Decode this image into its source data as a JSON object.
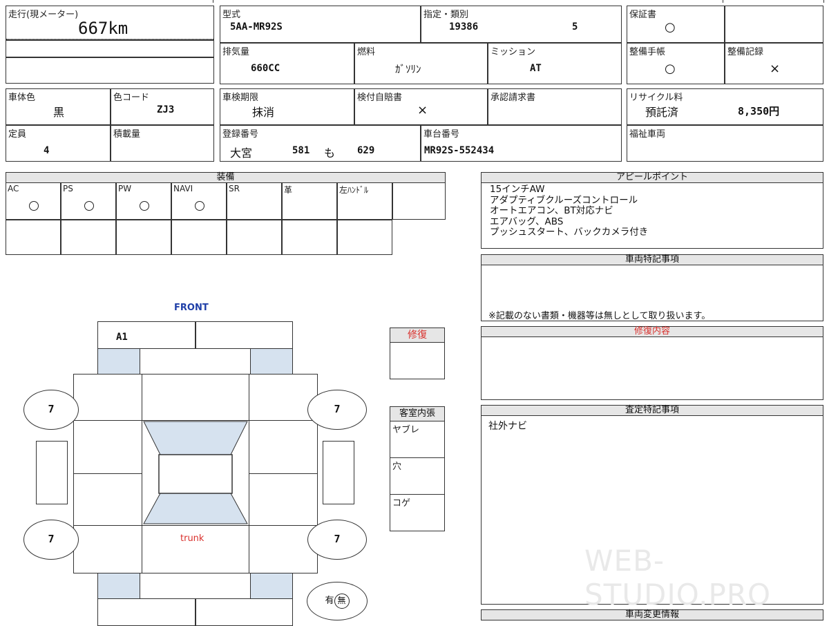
{
  "mileage": {
    "label": "走行(現メーター)",
    "value": "667km"
  },
  "model": {
    "label": "型式",
    "value": "5AA-MR92S"
  },
  "designation": {
    "label": "指定・類別",
    "value1": "19386",
    "value2": "5"
  },
  "warranty": {
    "label": "保証書",
    "value": "○"
  },
  "displacement": {
    "label": "排気量",
    "value": "660CC"
  },
  "fuel": {
    "label": "燃料",
    "value": "ｶﾞｿﾘﾝ"
  },
  "transmission": {
    "label": "ミッション",
    "value": "AT"
  },
  "maintenance_book": {
    "label": "整備手帳",
    "value": "○"
  },
  "maintenance_record": {
    "label": "整備記録",
    "value": "×"
  },
  "body_color": {
    "label": "車体色",
    "value": "黒"
  },
  "color_code": {
    "label": "色コード",
    "value": "ZJ3"
  },
  "inspection": {
    "label": "車検期限",
    "value": "抹消"
  },
  "insurance": {
    "label": "検付自賠書",
    "value": "×"
  },
  "approval": {
    "label": "承認請求書",
    "value": ""
  },
  "recycle": {
    "label": "リサイクル料",
    "status": "預託済",
    "amount": "8,350円"
  },
  "capacity": {
    "label": "定員",
    "value": "4"
  },
  "load": {
    "label": "積載量",
    "value": ""
  },
  "registration": {
    "label": "登録番号",
    "place": "大宮",
    "class": "581",
    "kana": "も",
    "number": "629"
  },
  "chassis": {
    "label": "車台番号",
    "value": "MR92S-552434"
  },
  "welfare": {
    "label": "福祉車両",
    "value": ""
  },
  "equipment": {
    "title": "装備",
    "items": [
      {
        "label": "AC",
        "value": "○"
      },
      {
        "label": "PS",
        "value": "○"
      },
      {
        "label": "PW",
        "value": "○"
      },
      {
        "label": "NAVI",
        "value": "○"
      },
      {
        "label": "SR",
        "value": ""
      },
      {
        "label": "革",
        "value": ""
      },
      {
        "label": "左ﾊﾝﾄﾞﾙ",
        "value": ""
      }
    ]
  },
  "appeal": {
    "title": "アピールポイント",
    "lines": [
      "15インチAW",
      "アダプティブクルーズコントロール",
      "オートエアコン、BT対応ナビ",
      "エアバッグ、ABS",
      "プッシュスタート、バックカメラ付き"
    ]
  },
  "vehicle_notes": {
    "title": "車両特記事項",
    "note": "※記載のない書類・機器等は無しとして取り扱います。"
  },
  "repair_detail": {
    "title": "修復内容"
  },
  "assessment": {
    "title": "査定特記事項",
    "text": "社外ナビ"
  },
  "change_info": {
    "title": "車両変更情報"
  },
  "repair": {
    "title": "修復"
  },
  "interior": {
    "title": "客室内張",
    "items": [
      "ヤブレ",
      "穴",
      "コゲ"
    ]
  },
  "diagram": {
    "front": "FRONT",
    "trunk": "trunk",
    "a1": "A1",
    "tire_fl": "7",
    "tire_fr": "7",
    "tire_rl": "7",
    "tire_rr": "7",
    "spare_yes": "有",
    "spare_no": "無"
  },
  "watermark": "WEB-STUDIO.PRO",
  "colors": {
    "accent_blue": "#1f3fa8",
    "accent_red": "#d9302c",
    "glass": "#d6e2ef",
    "header_gray": "#e6e6e6"
  }
}
